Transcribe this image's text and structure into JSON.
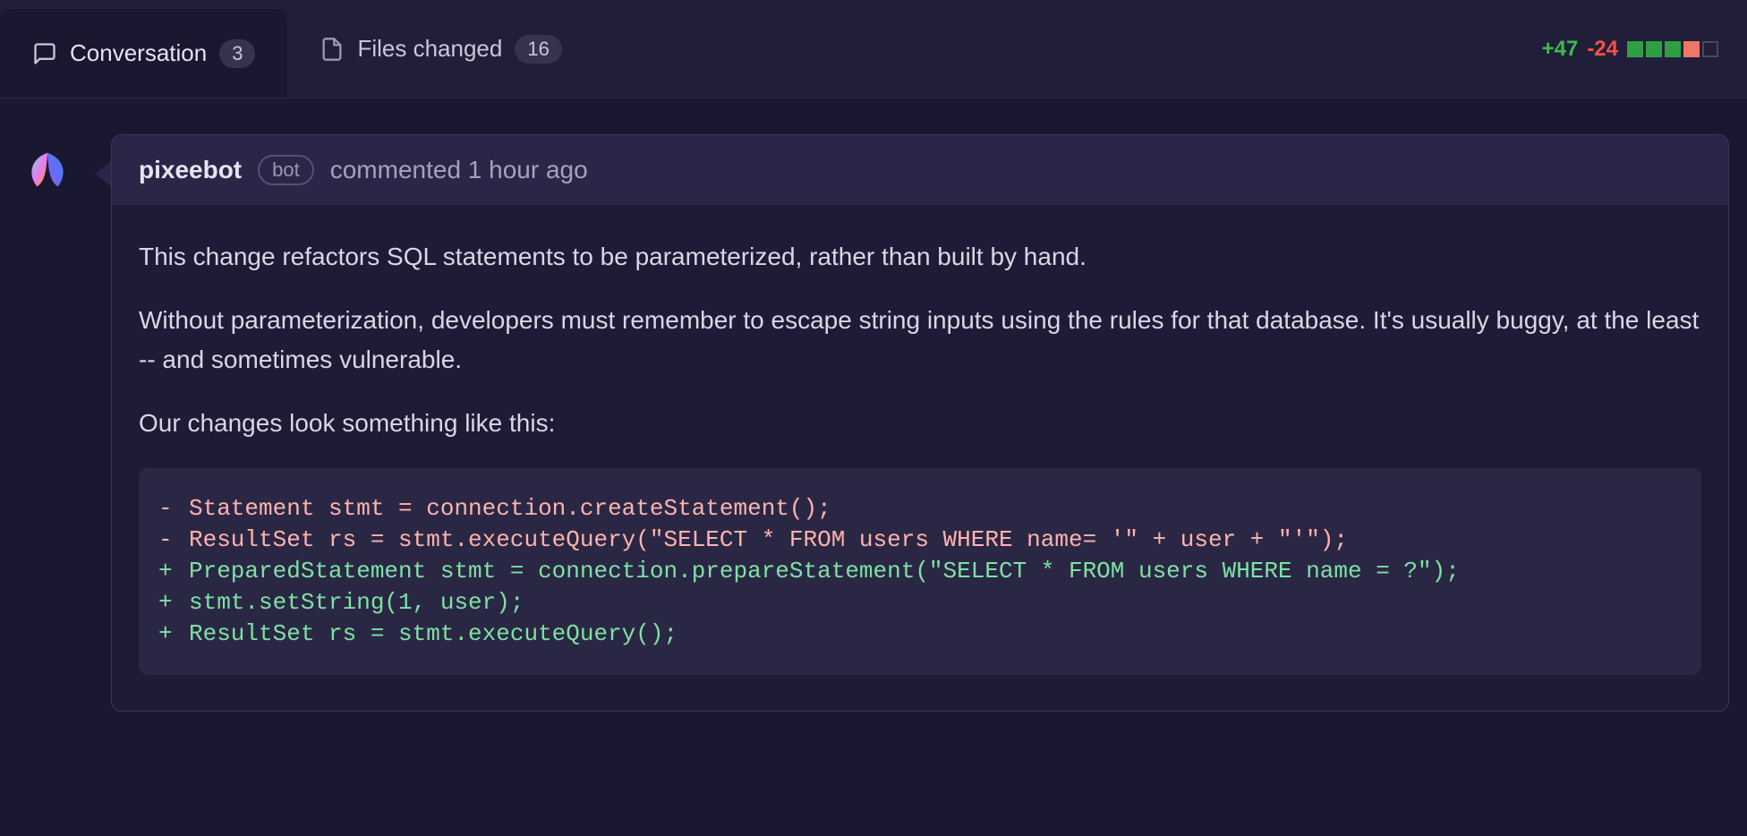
{
  "tabs": {
    "conversation": {
      "label": "Conversation",
      "count": "3"
    },
    "filesChanged": {
      "label": "Files changed",
      "count": "16"
    }
  },
  "diffstat": {
    "additions": "+47",
    "deletions": "-24",
    "squares": [
      "green",
      "green",
      "green",
      "red",
      "empty"
    ]
  },
  "comment": {
    "author": "pixeebot",
    "badge": "bot",
    "meta": "commented 1 hour ago",
    "paragraphs": [
      "This change refactors SQL statements to be parameterized, rather than built by hand.",
      "Without parameterization, developers must remember to escape string inputs using the rules for that database. It's usually buggy, at the least -- and sometimes vulnerable.",
      "Our changes look something like this:"
    ],
    "code": [
      {
        "type": "del",
        "prefix": "-",
        "text": "Statement stmt = connection.createStatement();"
      },
      {
        "type": "del",
        "prefix": "-",
        "text": "ResultSet rs = stmt.executeQuery(\"SELECT * FROM users WHERE name= '\" + user + \"'\");"
      },
      {
        "type": "add",
        "prefix": "+",
        "text": "PreparedStatement stmt = connection.prepareStatement(\"SELECT * FROM users WHERE name = ?\");"
      },
      {
        "type": "add",
        "prefix": "+",
        "text": "stmt.setString(1, user);"
      },
      {
        "type": "add",
        "prefix": "+",
        "text": "ResultSet rs = stmt.executeQuery();"
      }
    ]
  }
}
